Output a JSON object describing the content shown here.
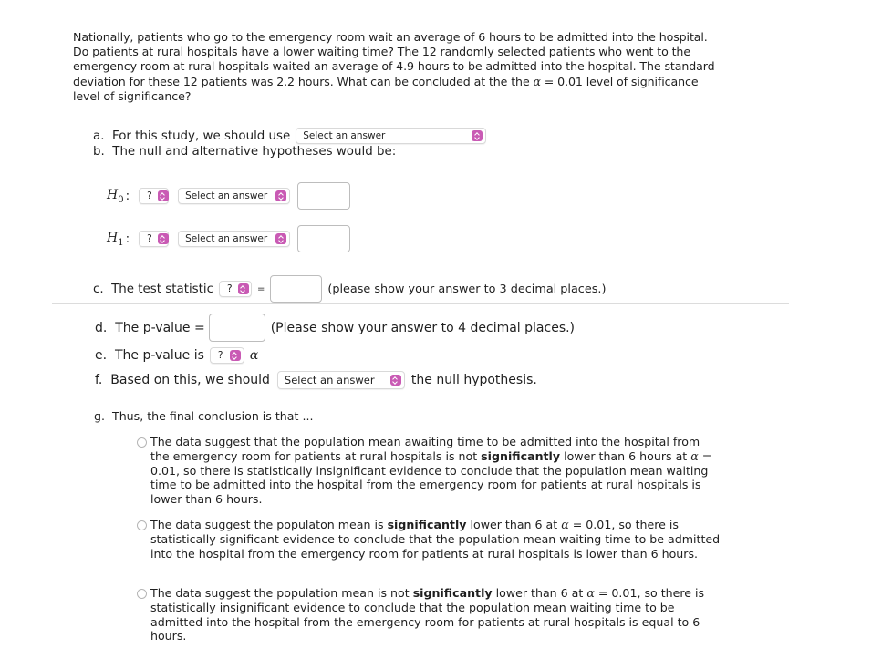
{
  "question": {
    "text_before_alpha": "Nationally, patients who go to the emergency room wait an average of 6 hours to be admitted into the hospital. Do patients at rural hospitals have a lower waiting time? The 12 randomly selected patients who went to the emergency room at rural hospitals waited an average of 4.9 hours to be admitted into the hospital. The standard deviation for these 12 patients was 2.2 hours. What can be concluded at the the",
    "alpha_symbol": "α",
    "text_after_alpha": " = 0.01 level of significance level of significance?"
  },
  "part_a": {
    "label": "a.  For this study, we should use",
    "select_value": "Select an answer"
  },
  "part_b": {
    "label": "b.  The null and alternative hypotheses would be:"
  },
  "h0": {
    "symbol": "H",
    "sub": "0",
    "colon": ":",
    "param_select": "?",
    "op_select": "Select an answer",
    "value": ""
  },
  "h1": {
    "symbol": "H",
    "sub": "1",
    "colon": ":",
    "param_select": "?",
    "op_select": "Select an answer",
    "value": ""
  },
  "part_c": {
    "label": "c.  The test statistic",
    "select_value": "?",
    "equals": "=",
    "value": "",
    "hint": "(please show your answer to 3 decimal places.)"
  },
  "part_d": {
    "label": "d.  The p-value =",
    "value": "",
    "hint": "(Please show your answer to 4 decimal places.)"
  },
  "part_e": {
    "label": "e.  The p-value is",
    "select_value": "?",
    "alpha_symbol": "α"
  },
  "part_f": {
    "label": "f.  Based on this, we should",
    "select_value": "Select an answer",
    "suffix": "the null hypothesis."
  },
  "part_g": {
    "label": "g.  Thus, the final conclusion is that ...",
    "options": [
      {
        "pre": "The data suggest that the population mean awaiting time to be admitted into the hospital from the emergency room for patients at rural hospitals is not ",
        "bold": "significantly",
        "mid": " lower than 6 hours at ",
        "alpha": "α",
        "post": " = 0.01, so there is statistically insignificant evidence to conclude that the population mean waiting time to be admitted into the hospital from the emergency room for patients at rural hospitals is lower than 6 hours."
      },
      {
        "pre": "The data suggest the populaton mean is ",
        "bold": "significantly",
        "mid": " lower than 6 at ",
        "alpha": "α",
        "post": " = 0.01, so there is statistically significant evidence to conclude that the population mean waiting time to be admitted into the hospital from the emergency room for patients at rural hospitals is lower than 6 hours."
      },
      {
        "pre": "The data suggest the population mean is not ",
        "bold": "significantly",
        "mid": " lower than 6 at ",
        "alpha": "α",
        "post": " = 0.01, so there is statistically insignificant evidence to conclude that the population mean waiting time to be admitted into the hospital from the emergency room for patients at rural hospitals is equal to 6 hours."
      }
    ]
  },
  "colors": {
    "select_accent": "#c95ab4",
    "divider": "#dcdcdc"
  }
}
